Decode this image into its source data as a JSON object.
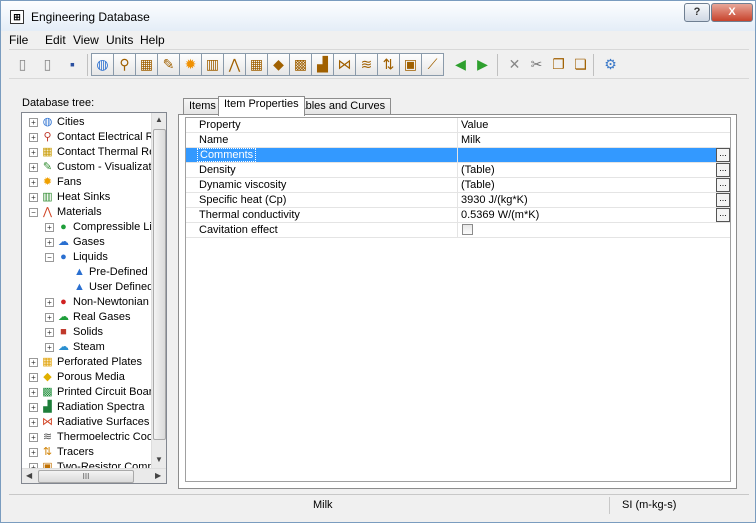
{
  "window": {
    "title": "Engineering Database",
    "help_label": "?",
    "close_label": "X"
  },
  "menu": [
    "File",
    "Edit",
    "View",
    "Units",
    "Help"
  ],
  "toolbar": [
    {
      "icon": "new-icon",
      "glyph": "▯"
    },
    {
      "icon": "open-icon",
      "glyph": "▯"
    },
    {
      "icon": "save-icon",
      "glyph": "▪"
    },
    {
      "icon": "globe-icon",
      "glyph": "◍"
    },
    {
      "icon": "contact-electrical-icon",
      "glyph": "⚲"
    },
    {
      "icon": "contact-thermal-icon",
      "glyph": "▦"
    },
    {
      "icon": "visualization-icon",
      "glyph": "✎"
    },
    {
      "icon": "fan-icon",
      "glyph": "✹"
    },
    {
      "icon": "heat-sink-icon",
      "glyph": "▥"
    },
    {
      "icon": "materials-icon",
      "glyph": "⋀"
    },
    {
      "icon": "perforated-plate-icon",
      "glyph": "▦"
    },
    {
      "icon": "porous-media-icon",
      "glyph": "◆"
    },
    {
      "icon": "pcb-icon",
      "glyph": "▩"
    },
    {
      "icon": "radiation-spectra-icon",
      "glyph": "▟"
    },
    {
      "icon": "radiative-surface-icon",
      "glyph": "⋈"
    },
    {
      "icon": "thermoelectric-cooler-icon",
      "glyph": "≋"
    },
    {
      "icon": "tracer-icon",
      "glyph": "⇅"
    },
    {
      "icon": "two-resistor-icon",
      "glyph": "▣"
    },
    {
      "icon": "units-icon",
      "glyph": "⟋"
    },
    {
      "icon": "arrow-left-icon",
      "glyph": "◀"
    },
    {
      "icon": "arrow-right-icon",
      "glyph": "▶"
    },
    {
      "icon": "delete-icon",
      "glyph": "✕"
    },
    {
      "icon": "cut-icon",
      "glyph": "✂"
    },
    {
      "icon": "copy-icon",
      "glyph": "❐"
    },
    {
      "icon": "paste-icon",
      "glyph": "❏"
    },
    {
      "icon": "settings-icon",
      "glyph": "⚙"
    }
  ],
  "tree_label": "Database tree:",
  "tree": [
    {
      "label": "Cities",
      "icon": "globe-icon",
      "glyph": "◍",
      "color": "#2a6fd0",
      "level": 0,
      "exp": "+"
    },
    {
      "label": "Contact Electrical Resis",
      "icon": "contact-electrical-icon",
      "glyph": "⚲",
      "color": "#c0392b",
      "level": 0,
      "exp": "+"
    },
    {
      "label": "Contact Thermal Resist",
      "icon": "contact-thermal-icon",
      "glyph": "▦",
      "color": "#c89a00",
      "level": 0,
      "exp": "+"
    },
    {
      "label": "Custom - Visualization F",
      "icon": "visualization-icon",
      "glyph": "✎",
      "color": "#2e8b2e",
      "level": 0,
      "exp": "+"
    },
    {
      "label": "Fans",
      "icon": "fan-icon",
      "glyph": "✹",
      "color": "#f0a000",
      "level": 0,
      "exp": "+"
    },
    {
      "label": "Heat Sinks",
      "icon": "heat-sink-icon",
      "glyph": "▥",
      "color": "#2e8b2e",
      "level": 0,
      "exp": "+"
    },
    {
      "label": "Materials",
      "icon": "materials-icon",
      "glyph": "⋀",
      "color": "#d04020",
      "level": 0,
      "exp": "−"
    },
    {
      "label": "Compressible Liquid",
      "icon": "liquid-drop-icon",
      "glyph": "●",
      "color": "#1e9e3a",
      "level": 1,
      "exp": "+"
    },
    {
      "label": "Gases",
      "icon": "gas-cloud-icon",
      "glyph": "☁",
      "color": "#2a6fd0",
      "level": 1,
      "exp": "+"
    },
    {
      "label": "Liquids",
      "icon": "liquid-drop-icon",
      "glyph": "●",
      "color": "#2a6fd0",
      "level": 1,
      "exp": "−"
    },
    {
      "label": "Pre-Defined",
      "icon": "predefined-folder-icon",
      "glyph": "▲",
      "color": "#2a6fd0",
      "level": 2,
      "exp": ""
    },
    {
      "label": "User Defined",
      "icon": "user-folder-icon",
      "glyph": "▲",
      "color": "#2a6fd0",
      "level": 2,
      "exp": ""
    },
    {
      "label": "Non-Newtonian Liq",
      "icon": "liquid-drop-icon",
      "glyph": "●",
      "color": "#d02020",
      "level": 1,
      "exp": "+"
    },
    {
      "label": "Real Gases",
      "icon": "gas-cloud-icon",
      "glyph": "☁",
      "color": "#1e9e3a",
      "level": 1,
      "exp": "+"
    },
    {
      "label": "Solids",
      "icon": "solid-cube-icon",
      "glyph": "■",
      "color": "#c0392b",
      "level": 1,
      "exp": "+"
    },
    {
      "label": "Steam",
      "icon": "steam-cloud-icon",
      "glyph": "☁",
      "color": "#2a8fd0",
      "level": 1,
      "exp": "+"
    },
    {
      "label": "Perforated Plates",
      "icon": "perforated-plate-icon",
      "glyph": "▦",
      "color": "#e0a000",
      "level": 0,
      "exp": "+"
    },
    {
      "label": "Porous Media",
      "icon": "porous-media-icon",
      "glyph": "◆",
      "color": "#e0b000",
      "level": 0,
      "exp": "+"
    },
    {
      "label": "Printed Circuit Boards",
      "icon": "pcb-icon",
      "glyph": "▩",
      "color": "#1e8e3a",
      "level": 0,
      "exp": "+"
    },
    {
      "label": "Radiation Spectra",
      "icon": "radiation-spectra-icon",
      "glyph": "▟",
      "color": "#1e7e3a",
      "level": 0,
      "exp": "+"
    },
    {
      "label": "Radiative Surfaces",
      "icon": "radiative-surface-icon",
      "glyph": "⋈",
      "color": "#d04020",
      "level": 0,
      "exp": "+"
    },
    {
      "label": "Thermoelectric Coolers",
      "icon": "thermoelectric-cooler-icon",
      "glyph": "≋",
      "color": "#555555",
      "level": 0,
      "exp": "+"
    },
    {
      "label": "Tracers",
      "icon": "tracer-icon",
      "glyph": "⇅",
      "color": "#d08000",
      "level": 0,
      "exp": "+"
    },
    {
      "label": "Two-Resistor Compone",
      "icon": "two-resistor-icon",
      "glyph": "▣",
      "color": "#c07000",
      "level": 0,
      "exp": "+"
    }
  ],
  "tabs": [
    "Items",
    "Item Properties",
    "Tables and Curves"
  ],
  "active_tab": 1,
  "grid": {
    "header": {
      "property": "Property",
      "value": "Value"
    },
    "rows": [
      {
        "property": "Name",
        "value": "Milk",
        "button": false,
        "checkbox": false
      },
      {
        "property": "Comments",
        "value": "",
        "button": true,
        "checkbox": false,
        "selected": true
      },
      {
        "property": "Density",
        "value": "(Table)",
        "button": true,
        "checkbox": false
      },
      {
        "property": "Dynamic viscosity",
        "value": "(Table)",
        "button": true,
        "checkbox": false
      },
      {
        "property": "Specific heat (Cp)",
        "value": "3930 J/(kg*K)",
        "button": true,
        "checkbox": false
      },
      {
        "property": "Thermal conductivity",
        "value": "0.5369 W/(m*K)",
        "button": true,
        "checkbox": false
      },
      {
        "property": "Cavitation effect",
        "value": "",
        "button": false,
        "checkbox": true
      }
    ],
    "button_label": "..."
  },
  "status": {
    "item": "Milk",
    "units": "SI (m-kg-s)"
  },
  "hscroll_grip": "III"
}
